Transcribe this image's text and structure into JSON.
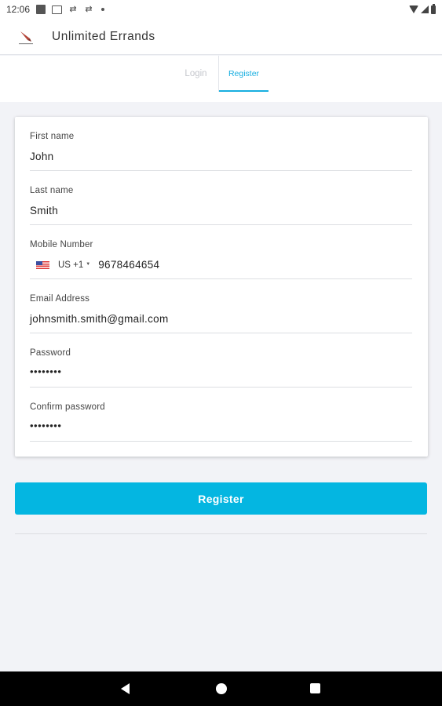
{
  "status_bar": {
    "time": "12:06"
  },
  "app": {
    "title": "Unlimited Errands",
    "logo": "errands-logo-icon"
  },
  "tabs": [
    {
      "label": "Login",
      "active": false
    },
    {
      "label": "Register",
      "active": true
    }
  ],
  "form": {
    "first_name": {
      "label": "First name",
      "value": "John"
    },
    "last_name": {
      "label": "Last name",
      "value": "Smith"
    },
    "mobile": {
      "label": "Mobile Number",
      "country": "US +1",
      "flag": "us-flag-icon",
      "value": "9678464654"
    },
    "email": {
      "label": "Email Address",
      "value": "johnsmith.smith@gmail.com"
    },
    "password": {
      "label": "Password",
      "value": "••••••••"
    },
    "confirm_password": {
      "label": "Confirm password",
      "value": "••••••••"
    }
  },
  "register_button": {
    "label": "Register"
  },
  "colors": {
    "accent": "#04b6e1",
    "tab_active": "#17aee0",
    "background": "#f2f3f7"
  }
}
